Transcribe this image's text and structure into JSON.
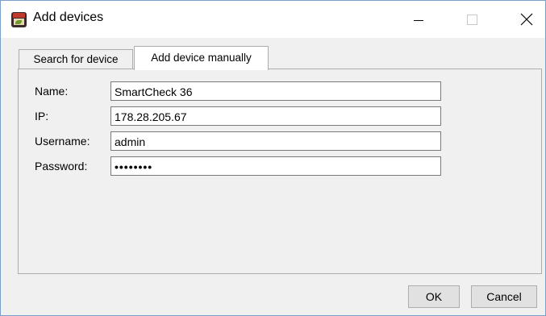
{
  "window": {
    "title": "Add devices"
  },
  "tabs": [
    {
      "label": "Search for device",
      "active": false
    },
    {
      "label": "Add device manually",
      "active": true
    }
  ],
  "form": {
    "name_label": "Name:",
    "name_value": "SmartCheck 36",
    "ip_label": "IP:",
    "ip_value": "178.28.205.67",
    "username_label": "Username:",
    "username_value": "admin",
    "password_label": "Password:",
    "password_value": "••••••••"
  },
  "buttons": {
    "ok": "OK",
    "cancel": "Cancel"
  },
  "icons": {
    "app": "app-icon",
    "minimize": "minimize-icon",
    "maximize": "maximize-icon",
    "close": "close-icon"
  }
}
